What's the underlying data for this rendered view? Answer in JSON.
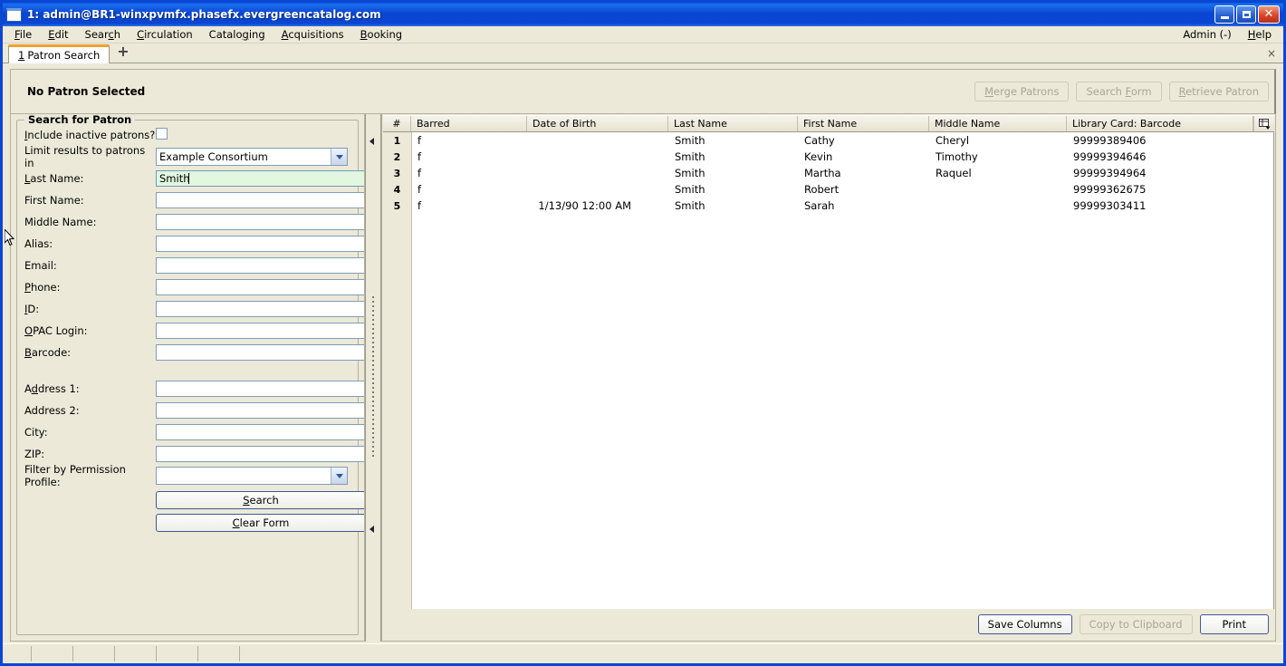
{
  "window": {
    "title": "1: admin@BR1-winxpvmfx.phasefx.evergreencatalog.com",
    "icon": "window-icon",
    "controls": {
      "minimize": "minimize-icon",
      "maximize": "maximize-icon",
      "close": "close-icon"
    }
  },
  "menubar": {
    "items": [
      {
        "label": "File",
        "mnemonic": "F"
      },
      {
        "label": "Edit",
        "mnemonic": "E"
      },
      {
        "label": "Search",
        "mnemonic": "c"
      },
      {
        "label": "Circulation",
        "mnemonic": "C"
      },
      {
        "label": "Cataloging",
        "mnemonic": "g"
      },
      {
        "label": "Acquisitions",
        "mnemonic": "A"
      },
      {
        "label": "Booking",
        "mnemonic": "B"
      }
    ],
    "right": [
      {
        "label": "Admin (-)",
        "mnemonic": ""
      },
      {
        "label": "Help",
        "mnemonic": "H"
      }
    ]
  },
  "tabs": {
    "active": {
      "number": "1",
      "label": "Patron Search"
    },
    "add_label": "+",
    "close_label": "×"
  },
  "patron_header": {
    "status": "No Patron Selected",
    "buttons": [
      {
        "label": "Merge Patrons",
        "enabled": false
      },
      {
        "label": "Search Form",
        "enabled": false
      },
      {
        "label": "Retrieve Patron",
        "enabled": false
      }
    ]
  },
  "search_form": {
    "legend": "Search for Patron",
    "include_inactive": {
      "label": "Include inactive patrons?",
      "checked": false
    },
    "limit_results": {
      "label": "Limit results to patrons in",
      "value": "Example Consortium"
    },
    "fields": [
      {
        "label": "Last Name:",
        "value": "Smith",
        "active": true
      },
      {
        "label": "First Name:",
        "value": "",
        "active": false
      },
      {
        "label": "Middle Name:",
        "value": "",
        "active": false
      },
      {
        "label": "Alias:",
        "value": "",
        "active": false
      },
      {
        "label": "Email:",
        "value": "",
        "active": false
      },
      {
        "label": "Phone:",
        "value": "",
        "active": false
      },
      {
        "label": "ID:",
        "value": "",
        "active": false
      },
      {
        "label": "OPAC Login:",
        "value": "",
        "active": false
      },
      {
        "label": "Barcode:",
        "value": "",
        "active": false
      }
    ],
    "address_fields": [
      {
        "label": "Address 1:",
        "value": ""
      },
      {
        "label": "Address 2:",
        "value": ""
      },
      {
        "label": "City:",
        "value": ""
      },
      {
        "label": "ZIP:",
        "value": ""
      }
    ],
    "permission_profile": {
      "label": "Filter by Permission Profile:",
      "value": ""
    },
    "search_button": "Search",
    "clear_button": "Clear Form"
  },
  "results": {
    "columns": [
      "#",
      "Barred",
      "Date of Birth",
      "Last Name",
      "First Name",
      "Middle Name",
      "Library Card: Barcode"
    ],
    "column_picker_icon": "column-picker-icon",
    "rows": [
      {
        "num": "1",
        "barred": "f",
        "dob": "",
        "last": "Smith",
        "first": "Cathy",
        "middle": "Cheryl",
        "barcode": "99999389406"
      },
      {
        "num": "2",
        "barred": "f",
        "dob": "",
        "last": "Smith",
        "first": "Kevin",
        "middle": "Timothy",
        "barcode": "99999394646"
      },
      {
        "num": "3",
        "barred": "f",
        "dob": "",
        "last": "Smith",
        "first": "Martha",
        "middle": "Raquel",
        "barcode": "99999394964"
      },
      {
        "num": "4",
        "barred": "f",
        "dob": "",
        "last": "Smith",
        "first": "Robert",
        "middle": "",
        "barcode": "99999362675"
      },
      {
        "num": "5",
        "barred": "f",
        "dob": "1/13/90 12:00 AM",
        "last": "Smith",
        "first": "Sarah",
        "middle": "",
        "barcode": "99999303411"
      }
    ],
    "footer_buttons": [
      {
        "label": "Save Columns",
        "enabled": true
      },
      {
        "label": "Copy to Clipboard",
        "enabled": false
      },
      {
        "label": "Print",
        "enabled": true
      }
    ]
  },
  "statusbar": {
    "segments": [
      "",
      "",
      "",
      "",
      "",
      "",
      ""
    ]
  },
  "colors": {
    "titlebar": "#0a46d2",
    "window_bg": "#ece9d8",
    "tab_accent": "#f0a030",
    "active_field_bg": "#e2f7df",
    "field_border": "#7f9db9"
  }
}
